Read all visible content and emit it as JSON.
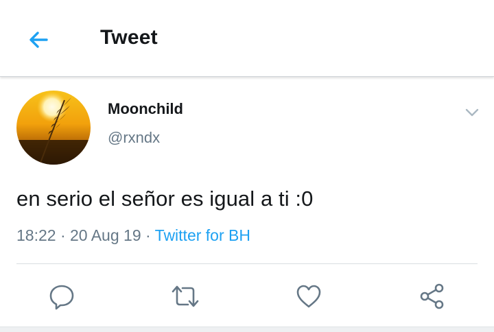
{
  "header": {
    "title": "Tweet",
    "back_icon": "arrow-left-icon"
  },
  "tweet": {
    "display_name": "Moonchild",
    "handle": "@rxndx",
    "text": "en serio el señor es igual a ti :0",
    "time": "18:22",
    "date": "20 Aug 19",
    "separator": "·",
    "source": "Twitter for BH",
    "avatar_description": "sunset-with-wheat-stalk"
  },
  "actions": [
    {
      "name": "reply",
      "icon": "reply-icon"
    },
    {
      "name": "retweet",
      "icon": "retweet-icon"
    },
    {
      "name": "like",
      "icon": "heart-icon"
    },
    {
      "name": "share",
      "icon": "share-icon"
    }
  ],
  "colors": {
    "accent": "#1da1f2",
    "text_primary": "#14171a",
    "text_secondary": "#657786"
  }
}
